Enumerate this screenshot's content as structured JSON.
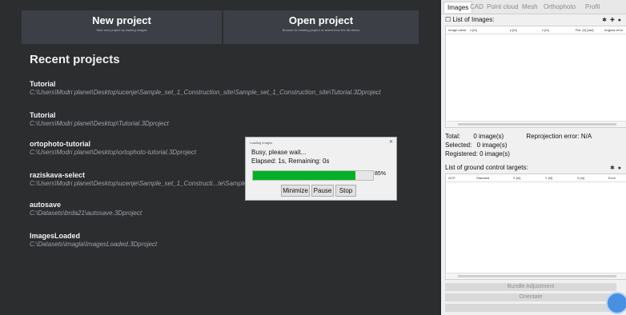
{
  "left": {
    "new_project": {
      "title": "New project",
      "subtitle": "Start new project by loading images"
    },
    "open_project": {
      "title": "Open project",
      "subtitle": "Browse for existing project or select from the list below"
    },
    "recent_title": "Recent projects",
    "projects": [
      {
        "name": "Tutorial",
        "path": "C:\\Users\\Modri planet\\Desktop\\ucenje\\Sample_set_1_Construction_site\\Sample_set_1_Construction_site\\Tutorial.3Dproject"
      },
      {
        "name": "Tutorial",
        "path": "C:\\Users\\Modri planet\\Desktop\\Tutorial.3Dproject"
      },
      {
        "name": "ortophoto-tutorial",
        "path": "C:\\Users\\Modri planet\\Desktop\\ortophoto-tutorial.3Dproject"
      },
      {
        "name": "raziskava-select",
        "path": "C:\\Users\\Modri planet\\Desktop\\ucenje\\Sample_set_1_Constructi...te\\Sample_set_1_Construction_site\\raziskava-select.3Dproject"
      },
      {
        "name": "autosave",
        "path": "C:\\Datasets\\brda21\\autosave.3Dproject"
      },
      {
        "name": "ImagesLoaded",
        "path": "C:\\Datasets\\imagla\\ImagesLoaded.3Dproject"
      }
    ]
  },
  "dialog": {
    "title": "Loading images",
    "message": "Busy, please wait...",
    "elapsed": "Elapsed: 1s, Remaining: 0s",
    "progress": 85,
    "progress_label": "85%",
    "buttons": {
      "minimize": "Minimize",
      "pause": "Pause",
      "stop": "Stop"
    }
  },
  "right": {
    "tabs": [
      "Images",
      "CAD",
      "Point cloud",
      "Mesh",
      "Orthophoto",
      "Profil"
    ],
    "images_header": "List of Images:",
    "images_columns": [
      "Image name",
      "x [m]",
      "y [m]",
      "z [m]",
      "Rot. [X] [rad]",
      "Angular error"
    ],
    "total": "Total:",
    "total_value": "0 image(s)",
    "reproj": "Reprojection error: N/A",
    "selected": "Selected:",
    "selected_value": "0 image(s)",
    "registered": "Registered: 0 image(s)",
    "gcp_header": "List of ground control targets:",
    "gcp_columns": [
      "GCP",
      "Standard",
      "X [m]",
      "Y [m]",
      "Z [m]",
      "Error"
    ],
    "buttons": {
      "bundle": "Bundle Adjustment",
      "orientate": "Orientate"
    }
  }
}
